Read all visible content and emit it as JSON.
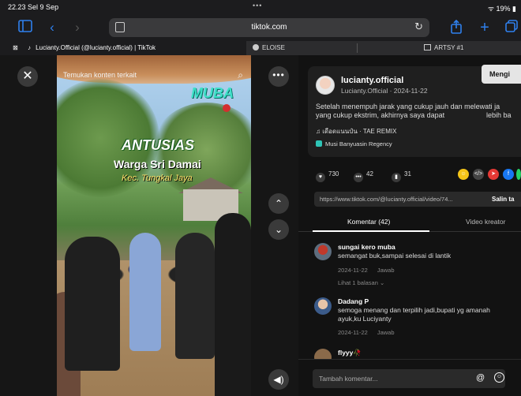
{
  "status": {
    "time": "22.23",
    "date": "Sel 9 Sep",
    "battery": "19%"
  },
  "toolbar": {
    "url": "tiktok.com"
  },
  "tabs": {
    "active": "Lucianty.Official (@lucianty.official) | TikTok",
    "second": "ELOISE",
    "third": "ARTSY #1"
  },
  "video": {
    "search_placeholder": "Temukan konten terkait",
    "overlay_logo": "MUBA",
    "overlay_title": "ANTUSIAS",
    "overlay_sub": "Warga Sri Damai",
    "overlay_kec": "Kec. Tungkal Jaya"
  },
  "post": {
    "username": "lucianty.official",
    "subline": "Lucianty.Official · 2024-11-22",
    "follow_label": "Mengi",
    "desc_line1": "Setelah menempuh jarak yang cukup jauh dan melewati ja",
    "desc_line2": "yang cukup ekstrim, akhirnya saya dapat",
    "desc_more": "lebih ba",
    "music": "♫  เดือดแนนป๋น · TAE REMIX",
    "location": "Musi Banyuasin Regency",
    "likes": "730",
    "comments": "42",
    "saves": "31",
    "link": "https://www.tiktok.com/@lucianty.official/video/74...",
    "copy_label": "Salin ta"
  },
  "panel_tabs": {
    "comments": "Komentar (42)",
    "creator": "Video kreator"
  },
  "comments": [
    {
      "user": "sungai kero muba",
      "text": "semangat buk,sampai selesai di lantik",
      "date": "2024-11-22",
      "reply": "Jawab",
      "more": "Lihat 1 balasan ⌄"
    },
    {
      "user": "Dadang P",
      "text": "semoga menang dan terpilih jadi,bupati yg amanah",
      "text2": "ayuk,ku Luciyanty",
      "date": "2024-11-22",
      "reply": "Jawab"
    },
    {
      "user": "flyyy🥀"
    }
  ],
  "comment_input": {
    "placeholder": "Tambah komentar..."
  },
  "colors": {
    "accent": "#2f80ed",
    "background": "#121212",
    "teal": "#2ec4b6"
  },
  "icons": [
    "close-icon",
    "more-icon",
    "chevron-up-icon",
    "chevron-down-icon",
    "volume-icon",
    "search-icon",
    "heart-icon",
    "comment-icon",
    "bookmark-icon",
    "share-icons",
    "at-icon",
    "emoji-icon"
  ]
}
